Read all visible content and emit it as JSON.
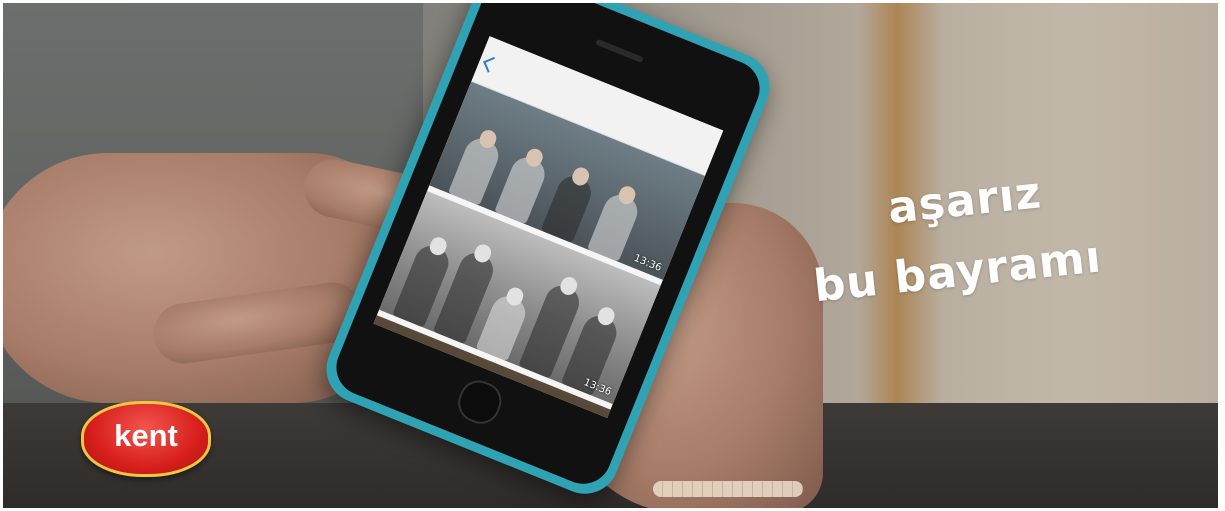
{
  "overlay": {
    "line1": "aşarız",
    "line2": "bu bayramı"
  },
  "logo": {
    "brand": "kent"
  },
  "phone": {
    "timestamps": [
      "13:36",
      "13:36"
    ]
  },
  "colors": {
    "phone_case": "#2fa3b3",
    "logo_red": "#d81f1c",
    "logo_ring": "#f3c542",
    "overlay_text": "#ffffff"
  }
}
